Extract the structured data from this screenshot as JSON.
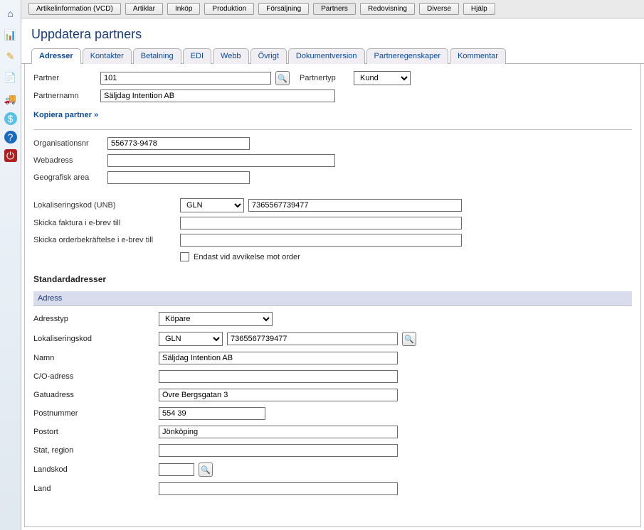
{
  "topmenu": [
    "Artikelinformation (VCD)",
    "Artiklar",
    "Inköp",
    "Produktion",
    "Försäljning",
    "Partners",
    "Redovisning",
    "Diverse",
    "Hjälp"
  ],
  "pageTitle": "Uppdatera partners",
  "tabs": [
    "Adresser",
    "Kontakter",
    "Betalning",
    "EDI",
    "Webb",
    "Övrigt",
    "Dokumentversion",
    "Partneregenskaper",
    "Kommentar"
  ],
  "partner": {
    "label": "Partner",
    "value": "101",
    "typeLabel": "Partnertyp",
    "typeValue": "Kund",
    "nameLabel": "Partnernamn",
    "nameValue": "Säljdag Intention AB",
    "copyLink": "Kopiera partner »"
  },
  "org": {
    "orgLabel": "Organisationsnr",
    "orgValue": "556773-9478",
    "webLabel": "Webadress",
    "webValue": "",
    "geoLabel": "Geografisk area",
    "geoValue": ""
  },
  "loc": {
    "locLabel": "Lokaliseringskod (UNB)",
    "locTypeValue": "GLN",
    "locValue": "7365567739477",
    "invoiceEmailLabel": "Skicka faktura i e-brev till",
    "invoiceEmailValue": "",
    "orderEmailLabel": "Skicka orderbekräftelse i e-brev till",
    "orderEmailValue": "",
    "deviationLabel": "Endast vid avvikelse mot order"
  },
  "stdAddr": {
    "heading": "Standardadresser",
    "subheader": "Adress",
    "typeLabel": "Adresstyp",
    "typeValue": "Köpare",
    "locLabel": "Lokaliseringskod",
    "locTypeValue": "GLN",
    "locValue": "7365567739477",
    "nameLabel": "Namn",
    "nameValue": "Säljdag Intention AB",
    "coLabel": "C/O-adress",
    "coValue": "",
    "streetLabel": "Gatuadress",
    "streetValue": "Övre Bergsgatan 3",
    "zipLabel": "Postnummer",
    "zipValue": "554 39",
    "cityLabel": "Postort",
    "cityValue": "Jönköping",
    "regionLabel": "Stat, region",
    "regionValue": "",
    "countryCodeLabel": "Landskod",
    "countryCodeValue": "",
    "countryLabel": "Land",
    "countryValue": ""
  }
}
